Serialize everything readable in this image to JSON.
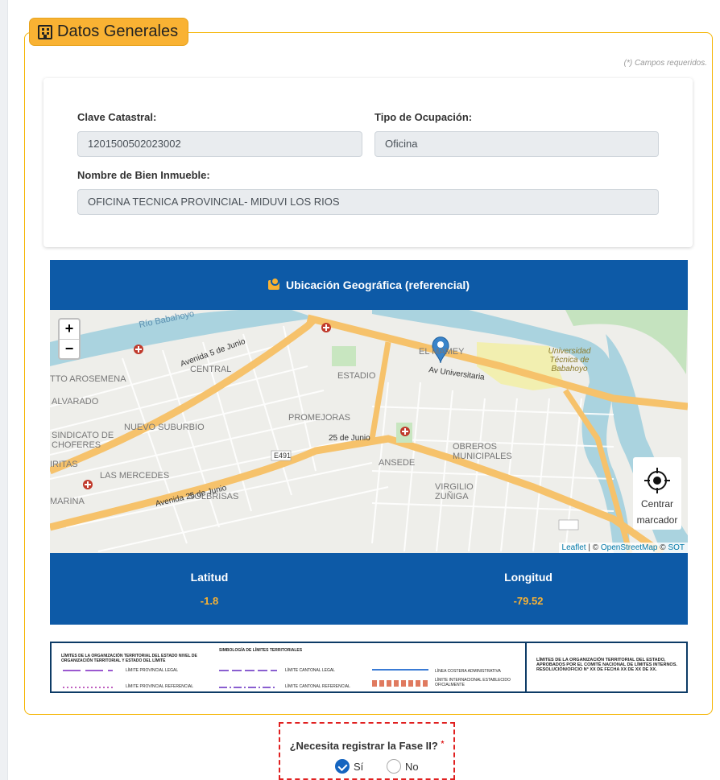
{
  "section": {
    "title": "Datos Generales",
    "required_note": "(*) Campos requeridos."
  },
  "form": {
    "clave_label": "Clave Catastral:",
    "clave_value": "1201500502023002",
    "tipo_label": "Tipo de Ocupación:",
    "tipo_value": "Oficina",
    "nombre_label": "Nombre de Bien Inmueble:",
    "nombre_value": "OFICINA TECNICA PROVINCIAL- MIDUVI LOS RIOS"
  },
  "geo": {
    "header": "Ubicación Geográfica (referencial)",
    "zoom_in": "+",
    "zoom_out": "−",
    "center_label_1": "Centrar",
    "center_label_2": "marcador",
    "attribution_leaflet": "Leaflet",
    "attribution_sep": " | © ",
    "attribution_osm": "OpenStreetMap",
    "attribution_copy": " © ",
    "attribution_sot": "SOT",
    "map_labels": {
      "el_mamey": "EL MAMEY",
      "av_universitaria": "Av Universitaria",
      "universidad": "Universidad Técnica de Babahoyo",
      "avenida_5_junio": "Avenida 5 de Junio",
      "nuevo_suburbio": "NUEVO SUBURBIO",
      "centro": "CENTRAL",
      "estadio": "ESTADIO",
      "promejoras": "PROMEJORAS",
      "obreros": "OBREROS MUNICIPALES",
      "ansede": "ANSEDE",
      "virgilio": "VIRGILIO ZUÑIGA",
      "las_mercedes": "LAS MERCEDES",
      "solbrisas": "SOLBRISAS",
      "sindicato": "SINDICATO DE CHOFERES",
      "alvarado": "ALVARADO",
      "arosemena": "TTO AROSEMENA",
      "marina": "MARINA",
      "iritas": "IRITAS",
      "av_25_junio": "Avenida 25 de Junio",
      "e491": "E491",
      "calle_25_junio": "25 de Junio",
      "rio": "Río Babahoyo"
    }
  },
  "coords": {
    "lat_label": "Latitud",
    "lat_value": "-1.8",
    "lon_label": "Longitud",
    "lon_value": "-79.52"
  },
  "legend": {
    "title_left": "LÍMITES DE LA ORGANIZACIÓN TERRITORIAL DEL ESTADO NIVEL DE ORGANIZACIÓN TERRITORIAL Y ESTADO DEL LÍMITE",
    "title_center": "SIMBOLOGÍA DE LÍMITES TERRITORIALES",
    "item1": "LÍMITE PROVINCIAL LEGAL",
    "item2": "LÍMITE PROVINCIAL REFERENCIAL",
    "item3": "LÍMITE CANTONAL LEGAL",
    "item4": "LÍMITE CANTONAL REFERENCIAL",
    "item5": "LÍNEA COSTERA ADMINISTRATIVA",
    "item6": "LÍMITE INTERNACIONAL ESTABLECIDO OFICIALMENTE",
    "note": "LÍMITES DE LA ORGANIZACIÓN TERRITORIAL DEL ESTADO, APROBADOS POR EL COMITÉ NACIONAL DE LÍMITES INTERNOS. RESOLUCIÓN/OFICIO N° XX DE FECHA XX DE XX DE XX."
  },
  "fase": {
    "question": "¿Necesita registrar la Fase II?",
    "required_mark": "*",
    "opt_si": "Sí",
    "opt_no": "No",
    "selected": "Sí"
  },
  "colors": {
    "accent": "#f9b233",
    "primary": "#0d5aa7",
    "required": "#e02020"
  }
}
